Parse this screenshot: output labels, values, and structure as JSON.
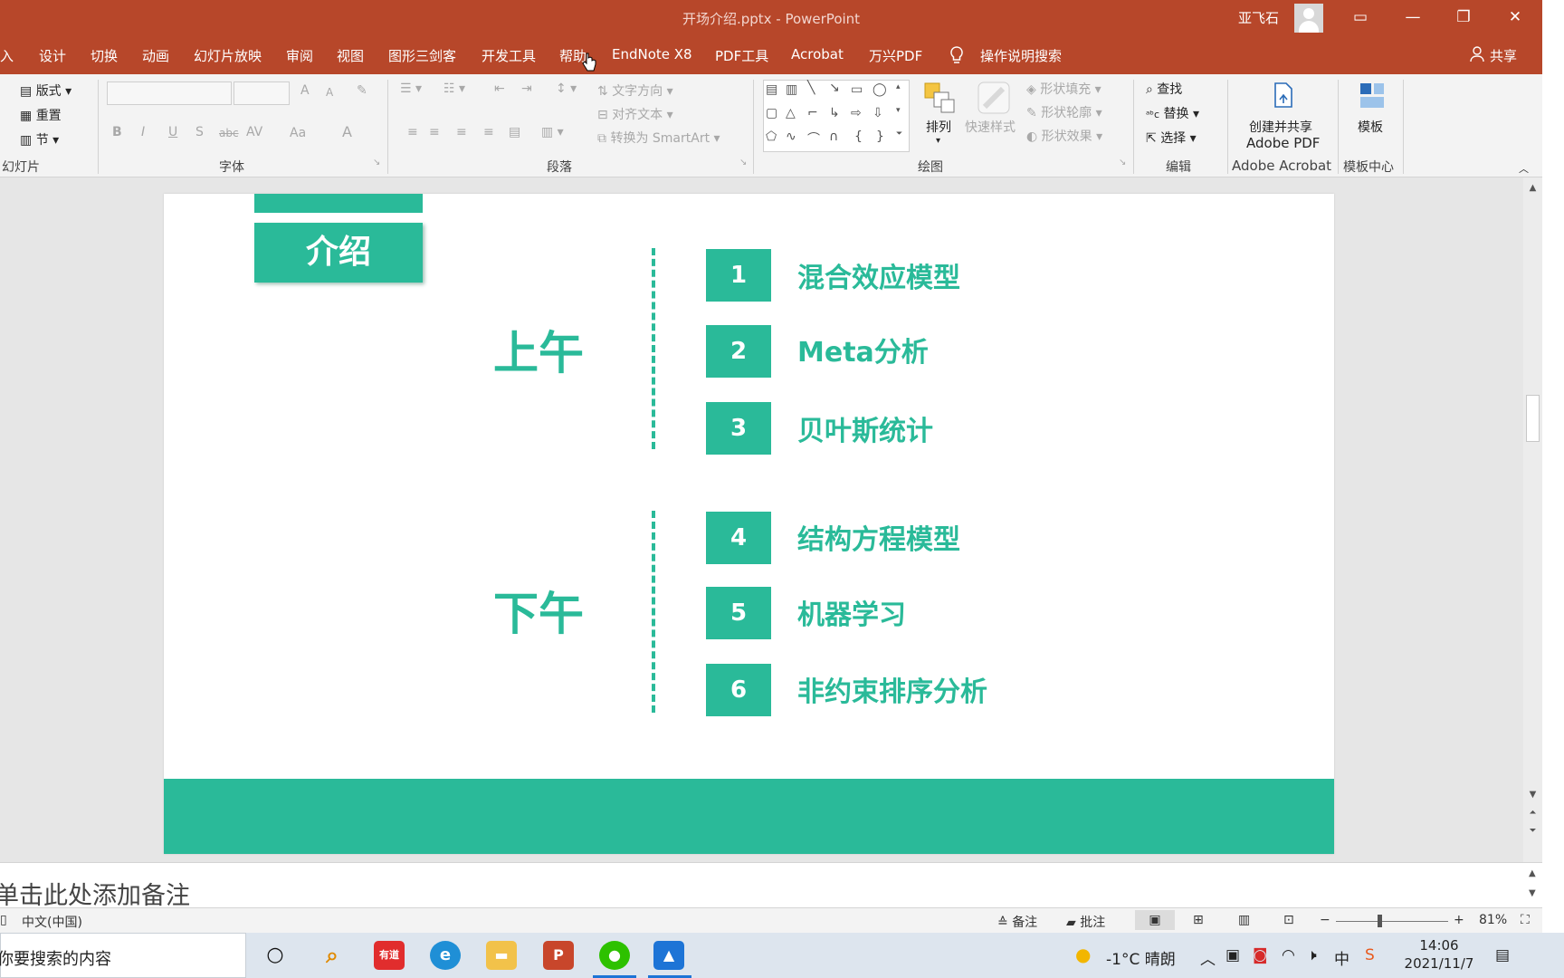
{
  "window": {
    "title": "开场介绍.pptx  -  PowerPoint",
    "user": "亚飞石",
    "controls": {
      "ribbon_display": "▭",
      "minimize": "—",
      "restore": "❐",
      "close": "✕"
    }
  },
  "menu": {
    "items": [
      "入",
      "设计",
      "切换",
      "动画",
      "幻灯片放映",
      "审阅",
      "视图",
      "图形三剑客",
      "开发工具",
      "帮助",
      "EndNote X8",
      "PDF工具",
      "Acrobat",
      "万兴PDF"
    ],
    "tell_me": "操作说明搜索",
    "share": "共享"
  },
  "ribbon": {
    "slides": {
      "layout": "版式",
      "reset": "重置",
      "section": "节",
      "label": "幻灯片"
    },
    "font": {
      "label": "字体",
      "bold": "B",
      "italic": "I",
      "underline": "U",
      "shadow": "S",
      "strike": "abc",
      "spacing": "AV",
      "case": "Aa",
      "color": "A",
      "grow": "A",
      "shrink": "A"
    },
    "paragraph": {
      "label": "段落",
      "text_direction": "文字方向",
      "align_text": "对齐文本",
      "smartart": "转换为 SmartArt"
    },
    "drawing": {
      "label": "绘图",
      "arrange": "排列",
      "quick_styles": "快速样式",
      "shape_fill": "形状填充",
      "shape_outline": "形状轮廓",
      "shape_effects": "形状效果"
    },
    "editing": {
      "label": "编辑",
      "find": "查找",
      "replace": "替换",
      "select": "选择"
    },
    "acrobat": {
      "create_share_line1": "创建并共享",
      "create_share_line2": "Adobe PDF",
      "label": "Adobe Acrobat"
    },
    "templates": {
      "button": "模板",
      "label": "模板中心"
    }
  },
  "slide": {
    "intro_label": "介绍",
    "morning": "上午",
    "afternoon": "下午",
    "topics": [
      {
        "num": "1",
        "text": "混合效应模型"
      },
      {
        "num": "2",
        "text": "Meta分析"
      },
      {
        "num": "3",
        "text": "贝叶斯统计"
      },
      {
        "num": "4",
        "text": "结构方程模型"
      },
      {
        "num": "5",
        "text": "机器学习"
      },
      {
        "num": "6",
        "text": "非约束排序分析"
      }
    ],
    "accent_color": "#2aba99"
  },
  "notes": {
    "placeholder": "单击此处添加备注"
  },
  "status": {
    "language": "中文(中国)",
    "notes_btn": "备注",
    "comments_btn": "批注",
    "zoom": "81%",
    "zoom_minus": "−",
    "zoom_plus": "+"
  },
  "taskbar": {
    "search_placeholder": "你要搜索的内容",
    "apps": [
      "cortana",
      "search-tool",
      "youdao",
      "edge",
      "file-explorer",
      "powerpoint",
      "wechat",
      "photos"
    ],
    "youdao_label": "有道",
    "ppt_label": "P",
    "weather": "-1°C  晴朗",
    "ime": "中",
    "time": "14:06",
    "date": "2021/11/7"
  }
}
